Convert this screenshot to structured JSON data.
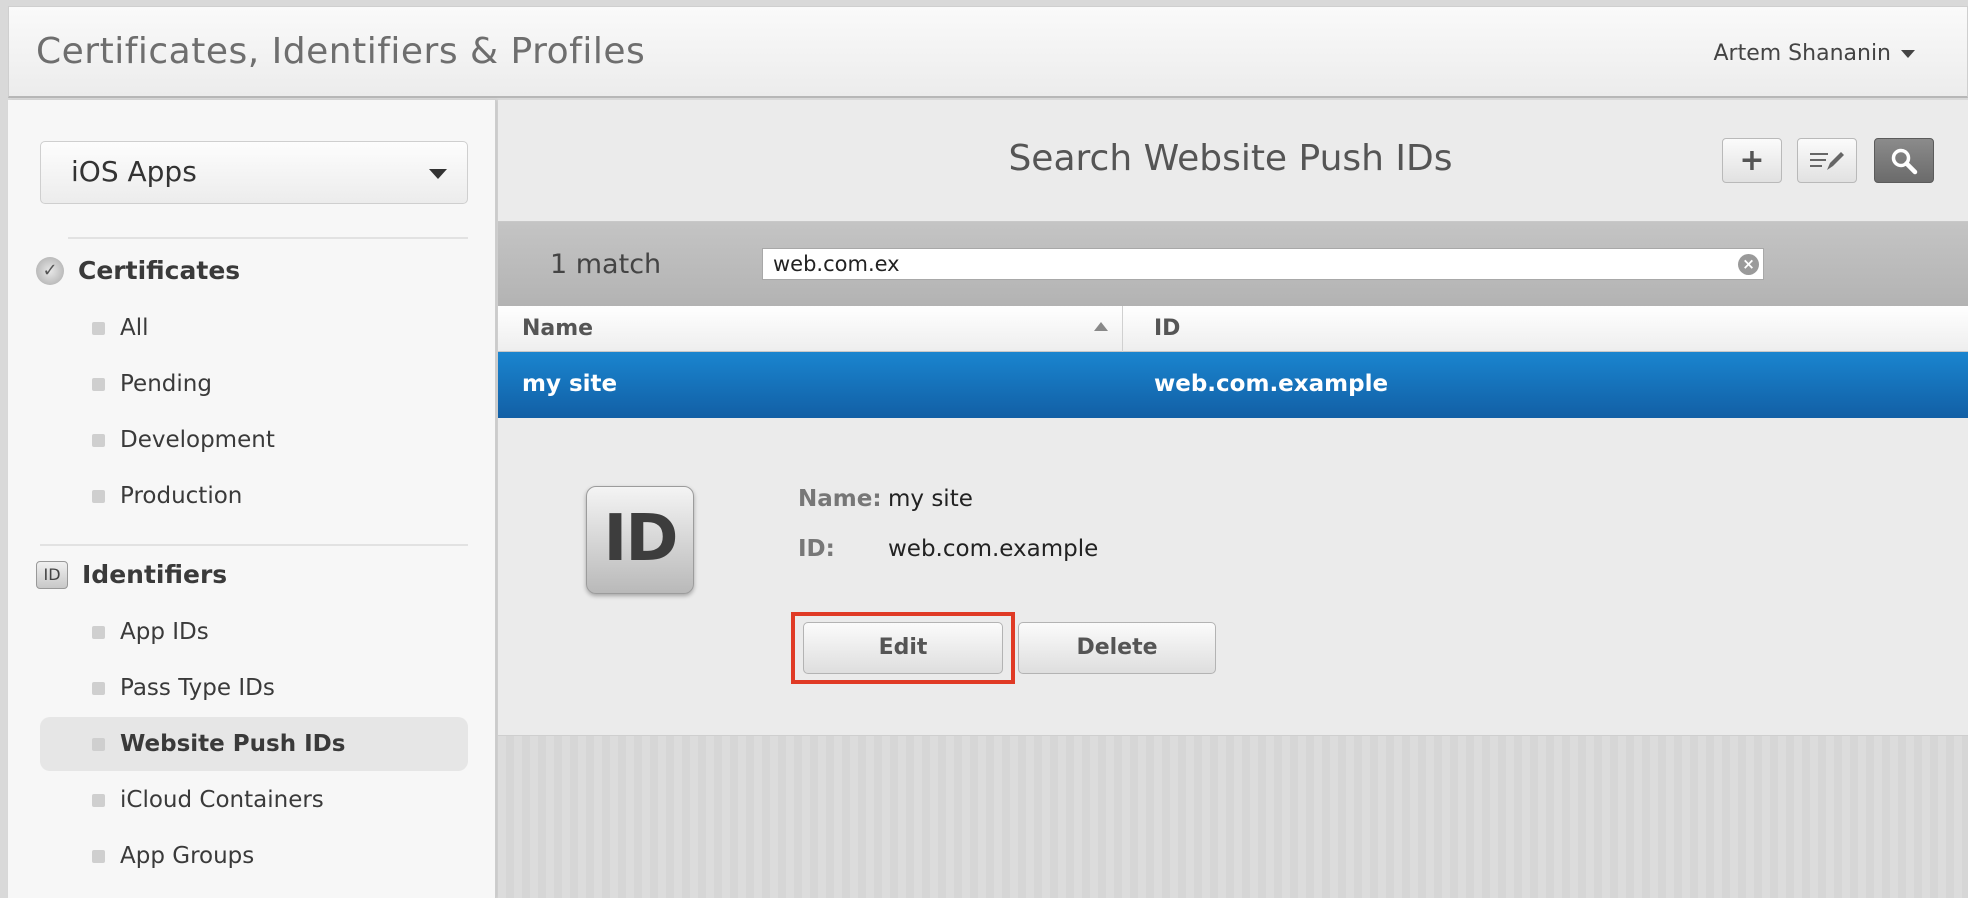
{
  "header": {
    "title": "Certificates, Identifiers & Profiles",
    "user": "Artem Shananin"
  },
  "sidebar": {
    "platform": "iOS Apps",
    "certificates": {
      "heading": "Certificates",
      "items": [
        "All",
        "Pending",
        "Development",
        "Production"
      ]
    },
    "identifiers": {
      "heading": "Identifiers",
      "icon_text": "ID",
      "items": [
        "App IDs",
        "Pass Type IDs",
        "Website Push IDs",
        "iCloud Containers",
        "App Groups"
      ]
    }
  },
  "main": {
    "title": "Search Website Push IDs",
    "toolbar": {
      "add_icon": "plus-icon",
      "edit_icon": "edit-list-icon",
      "search_icon": "search-icon"
    },
    "match_count": "1 match",
    "search_value": "web.com.ex",
    "columns": [
      "Name",
      "ID"
    ],
    "rows": [
      {
        "name": "my site",
        "id": "web.com.example"
      }
    ],
    "detail": {
      "badge": "ID",
      "name_label": "Name:",
      "name_value": "my site",
      "id_label": "ID:",
      "id_value": "web.com.example",
      "edit_label": "Edit",
      "delete_label": "Delete"
    }
  },
  "colors": {
    "selection": "#1a85cf",
    "highlight": "#e03a25"
  }
}
